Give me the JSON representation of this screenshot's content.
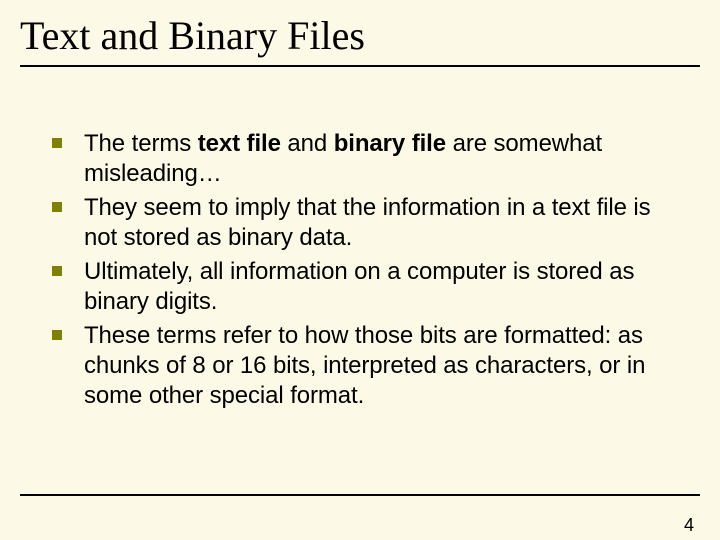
{
  "title": "Text and Binary Files",
  "bullets": [
    {
      "pre": "The terms ",
      "b1": "text file",
      "mid": " and ",
      "b2": "binary file",
      "post": " are somewhat misleading…"
    },
    {
      "text": "They seem to imply that the information in a text file is not stored as binary data."
    },
    {
      "text": "Ultimately, all information on a computer is stored as binary digits."
    },
    {
      "text": "These terms refer to how those bits are formatted: as chunks of 8 or 16 bits, interpreted as characters, or in some other special format."
    }
  ],
  "pageNumber": "4"
}
